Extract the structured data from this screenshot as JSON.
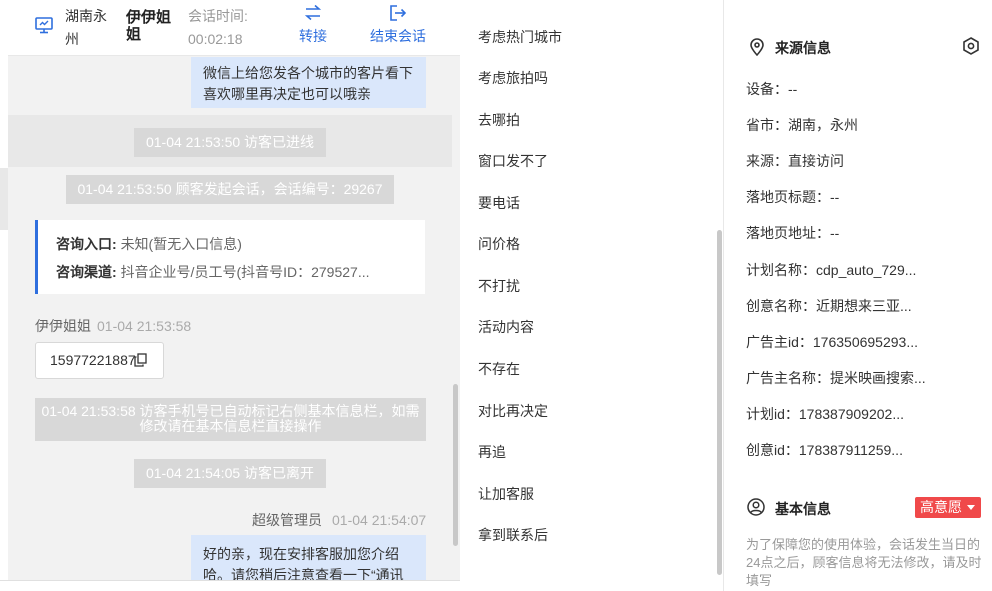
{
  "header": {
    "region": "湖南永州",
    "visitor_name": "伊伊姐姐",
    "session_time_label": "会话时间:",
    "session_time_value": "00:02:18",
    "transfer_label": "转接",
    "end_session_label": "结束会话"
  },
  "chat": {
    "msg_top": "微信上给您发各个城市的客片看下喜欢哪里再决定也可以哦亲",
    "sys_1": "01-04 21:53:50 访客已进线",
    "sys_2": "01-04 21:53:50 顾客发起会话，会话编号：29267",
    "entry_label": "咨询入口:",
    "entry_value": "未知(暂无入口信息)",
    "channel_label": "咨询渠道:",
    "channel_value": "抖音企业号/员工号(抖音号ID：279527...",
    "sender_visitor": "伊伊姐姐",
    "sender_visitor_time": "01-04 21:53:58",
    "phone": "15977221887",
    "sys_3": "01-04 21:53:58 访客手机号已自动标记右侧基本信息栏，如需修改请在基本信息栏直接操作",
    "sys_4": "01-04 21:54:05 访客已离开",
    "sender_admin": "超级管理员",
    "sender_admin_time": "01-04 21:54:07",
    "msg_bottom": "好的亲，现在安排客服加您介绍哈。请您稍后注意查看一下“通讯"
  },
  "phrases": [
    "考虑热门城市",
    "考虑旅拍吗",
    "去哪拍",
    "窗口发不了",
    "要电话",
    "问价格",
    "不打扰",
    "活动内容",
    "不存在",
    "对比再决定",
    "再追",
    "让加客服",
    "拿到联系后"
  ],
  "source_info": {
    "title": "来源信息",
    "rows": [
      "设备：--",
      "省市：湖南，永州",
      "来源：直接访问",
      "落地页标题：--",
      "落地页地址：--",
      "计划名称：cdp_auto_729...",
      "创意名称：近期想来三亚...",
      "广告主id：176350695293...",
      "广告主名称：提米映画搜索...",
      "计划id：178387909202...",
      "创意id：178387911259..."
    ]
  },
  "basic_info": {
    "title": "基本信息",
    "intent": "高意愿",
    "intent_color": "#f0494a",
    "notice": "为了保障您的使用体验，会话发生当日的24点之后，顾客信息将无法修改，请及时填写"
  },
  "colors": {
    "accent": "#2f6fde",
    "bubble": "#dae7fb",
    "system": "#d8d8d8"
  }
}
